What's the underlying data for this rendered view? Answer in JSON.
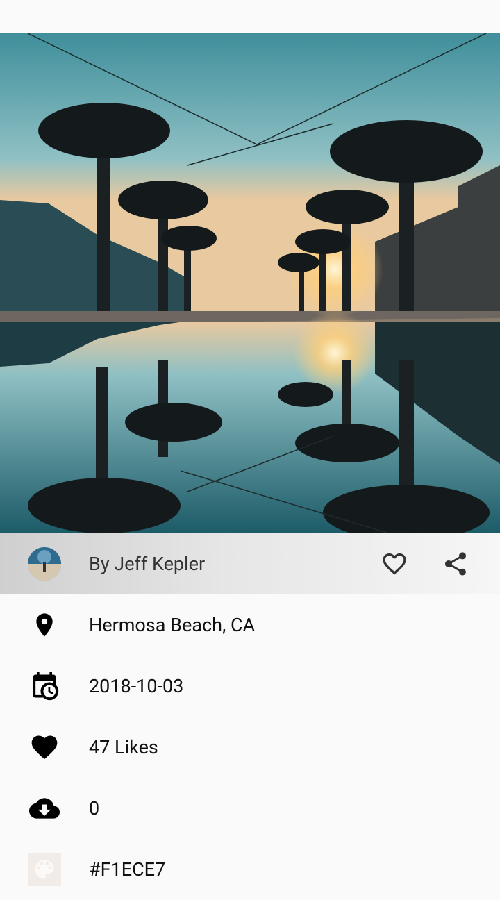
{
  "photo": {
    "description_icon": "photo-image"
  },
  "author": {
    "label": "By Jeff Kepler",
    "avatar_icon": "avatar"
  },
  "actions": {
    "like_icon": "heart-outline-icon",
    "share_icon": "share-icon"
  },
  "details": {
    "location": "Hermosa Beach, CA",
    "date": "2018-10-03",
    "likes": "47 Likes",
    "downloads": "0",
    "color": "#F1ECE7"
  },
  "colors": {
    "swatch": "#F1ECE7",
    "accent": "#000000"
  }
}
